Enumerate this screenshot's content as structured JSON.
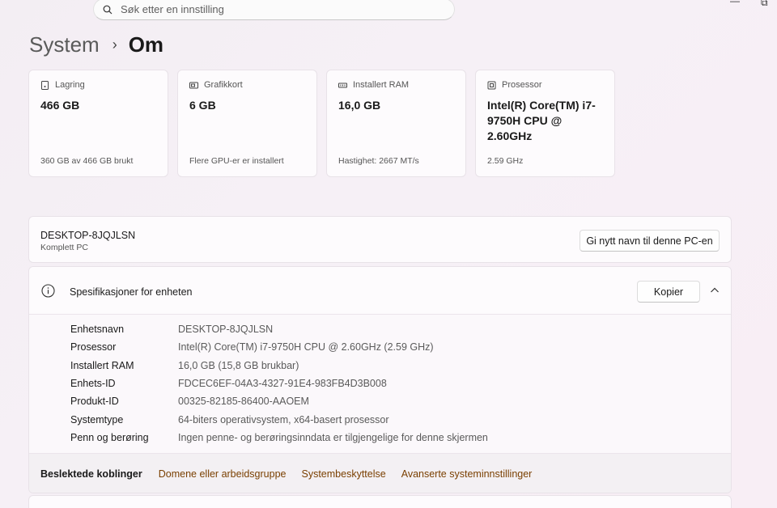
{
  "search": {
    "placeholder": "Søk etter en innstilling"
  },
  "window_controls": {
    "minimize": "—",
    "restore": "⧉"
  },
  "breadcrumb": {
    "parent": "System",
    "separator": "›",
    "current": "Om"
  },
  "cards": [
    {
      "icon": "storage-icon",
      "label": "Lagring",
      "value": "466 GB",
      "sub": "360 GB av 466 GB brukt"
    },
    {
      "icon": "graphics-card-icon",
      "label": "Grafikkort",
      "value": "6 GB",
      "sub": "Flere GPU-er er installert"
    },
    {
      "icon": "ram-icon",
      "label": "Installert RAM",
      "value": "16,0 GB",
      "sub": "Hastighet: 2667 MT/s"
    },
    {
      "icon": "processor-icon",
      "label": "Prosessor",
      "value": "Intel(R) Core(TM) i7-9750H CPU @ 2.60GHz",
      "sub": "2.59 GHz"
    }
  ],
  "pc": {
    "name": "DESKTOP-8JQJLSN",
    "model": "Komplett PC",
    "rename_label": "Gi nytt navn til denne PC-en"
  },
  "specs": {
    "title": "Spesifikasjoner for enheten",
    "copy_label": "Kopier",
    "rows": [
      {
        "key": "Enhetsnavn",
        "value": "DESKTOP-8JQJLSN"
      },
      {
        "key": "Prosessor",
        "value": "Intel(R) Core(TM) i7-9750H CPU @ 2.60GHz (2.59 GHz)"
      },
      {
        "key": "Installert RAM",
        "value": "16,0 GB (15,8 GB brukbar)"
      },
      {
        "key": "Enhets-ID",
        "value": "FDCEC6EF-04A3-4327-91E4-983FB4D3B008"
      },
      {
        "key": "Produkt-ID",
        "value": "00325-82185-86400-AAOEM"
      },
      {
        "key": "Systemtype",
        "value": "64-biters operativsystem, x64-basert prosessor"
      },
      {
        "key": "Penn og berøring",
        "value": "Ingen penne- og berøringsinndata er tilgjengelige for denne skjermen"
      }
    ]
  },
  "related": {
    "label": "Beslektede koblinger",
    "links": [
      "Domene eller arbeidsgruppe",
      "Systembeskyttelse",
      "Avanserte systeminnstillinger"
    ]
  },
  "colors": {
    "link": "#7a3f00",
    "background": "#f5eff5"
  }
}
